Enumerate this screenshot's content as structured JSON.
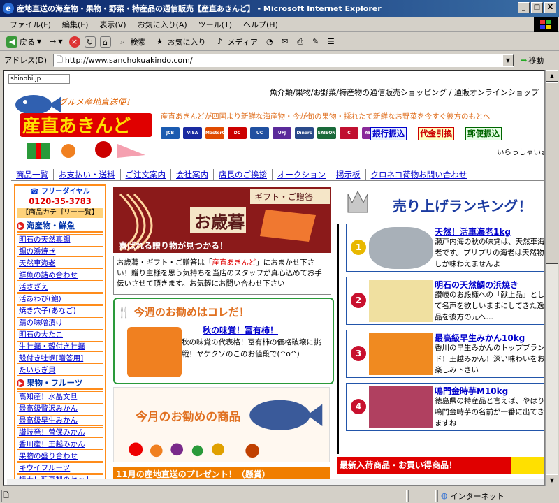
{
  "window": {
    "title": "産地直送の海産物・果物・野菜・特産品の通信販売【産直あきんど】 - Microsoft Internet Explorer",
    "min": "_",
    "max": "□",
    "close": "X"
  },
  "menu": [
    "ファイル(F)",
    "編集(E)",
    "表示(V)",
    "お気に入り(A)",
    "ツール(T)",
    "ヘルプ(H)"
  ],
  "toolbar": {
    "back": "戻る",
    "forward": "→",
    "search": "検索",
    "favorites": "お気に入り",
    "media": "メディア"
  },
  "address": {
    "label": "アドレス(D)",
    "url": "http://www.sanchokuakindo.com/",
    "go": "移動"
  },
  "status": {
    "zone": "インターネット"
  },
  "page": {
    "shinobi": "shinobi.jp",
    "logo_main": "産直あきんど",
    "logo_sub": "グルメ産地直送便！",
    "tagline_top": "魚介類/果物/お野菜/特産物の通信販売ショッピング / 通販オンラインショップ",
    "tagline_desc": "産直あきんどが四国より新鮮な海産物・今が旬の果物・採れたて新鮮なお野菜を今すぐ彼方のもとへ",
    "cards": [
      "JCB",
      "VISA",
      "MasterCard",
      "DC",
      "UC",
      "UFJ",
      "Diners",
      "SAISON",
      "C",
      "AEON"
    ],
    "pay": [
      "銀行振込",
      "代金引換",
      "郵便振込"
    ],
    "welcome": "いらっしゃいま",
    "nav": [
      "商品一覧",
      "お支払い・送料",
      "ご注文案内",
      "会社案内",
      "店長のご挨拶",
      "オークション",
      "掲示板",
      "クロネコ荷物お問い合わせ"
    ],
    "sidebar": {
      "freedial": "フリーダイヤル",
      "phone": "0120-35-3783",
      "cathead": "【商品カテゴリー一覧】",
      "sec1": "海産物・鮮魚",
      "sec1_items": [
        "明石の天然真鯛",
        "鯛の浜焼き",
        "天然車海老",
        "鮮魚の詰め合わせ",
        "活さざえ",
        "活あわび(鮑)",
        "焼き穴子(あなご)",
        "鯖の味噌漬け",
        "明石の大たこ",
        "生牡蠣・殻付き牡蠣",
        "殻付き牡蠣[贈答用]",
        "たいらぎ貝"
      ],
      "sec2": "果物・フルーツ",
      "sec2_items": [
        "高知産！水晶文旦",
        "最高級贅沢みかん",
        "最高級早生みかん",
        "讃岐発！曽保みかん",
        "香川産！王越みかん",
        "果物の盛り合わせ",
        "キウイフルーツ",
        "特大！新高梨のセット"
      ]
    },
    "banner1": {
      "title": "お歳暮",
      "sub": "ギフト・ご贈答",
      "caption": "喜ばれる贈り物が見つかる！"
    },
    "b1text": {
      "p1": "お歳暮・ギフト・ご贈答は「",
      "hl": "産直あきんど",
      "p2": "」におまかせ下さい！贈り主様を思う気持ちを当店のスタッフが真心込めてお手伝いさせて頂きます。お気軽にお問い合わせ下さい"
    },
    "week": {
      "head": "今週のお勧めはコレだ！",
      "title": "秋の味覚！冨有柿！",
      "desc": "秋の味覚の代表格！冨有柿の価格破壊に挑戦！ヤケクソのこのお値段で(^o^)"
    },
    "banner2": {
      "text": "今月のお勧めの商品"
    },
    "b2label": "11月の産地直送のプレゼント！（懸賞）",
    "ranking": {
      "head": "売り上げランキング！",
      "items": [
        {
          "num": "1",
          "title": "天然！活車海老1kg",
          "desc": "瀬戸内海の秋の味覚は、天然車海老です。プリプリの海老は天然物しか味わえませんよ"
        },
        {
          "num": "2",
          "title": "明石の天然鯛の浜焼き",
          "desc": "讃岐のお殿様への「献上品」として名声を欲しいままにしてきた逸品を彼方の元へ…"
        },
        {
          "num": "3",
          "title": "最高級早生みかん10kg",
          "desc": "香川の早生みかんのトップブランド！王越みかん！深い味わいをお楽しみ下さい"
        },
        {
          "num": "4",
          "title": "鳴門金時芋M10kg",
          "desc": "徳島県の特産品と言えば、やはり鳴門金時芋の名前が一番に出てきますね"
        }
      ]
    },
    "newbar": "最新入荷商品・お買い得商品！"
  }
}
